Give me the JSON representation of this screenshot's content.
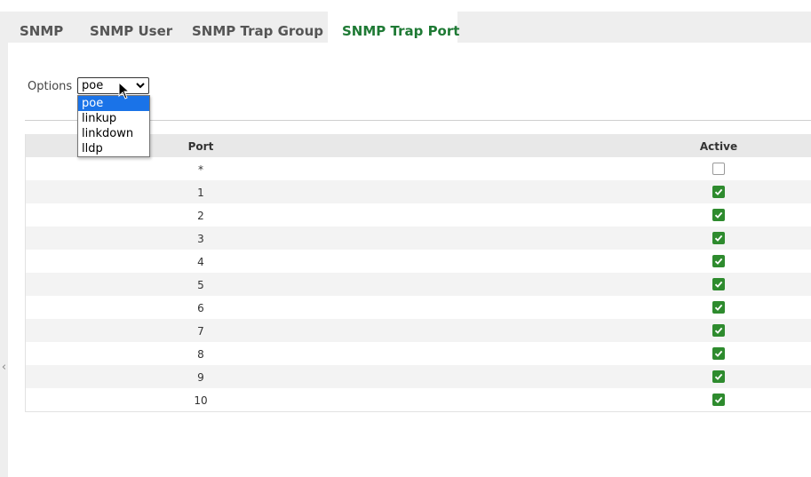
{
  "tabs": [
    {
      "label": "SNMP",
      "active": false
    },
    {
      "label": "SNMP User",
      "active": false
    },
    {
      "label": "SNMP Trap Group",
      "active": false
    },
    {
      "label": "SNMP Trap Port",
      "active": true
    }
  ],
  "options": {
    "label": "Options",
    "selected": "poe",
    "items": [
      "poe",
      "linkup",
      "linkdown",
      "lldp"
    ]
  },
  "table": {
    "headers": {
      "port": "Port",
      "active": "Active"
    },
    "rows": [
      {
        "port": "*",
        "active": false
      },
      {
        "port": "1",
        "active": true
      },
      {
        "port": "2",
        "active": true
      },
      {
        "port": "3",
        "active": true
      },
      {
        "port": "4",
        "active": true
      },
      {
        "port": "5",
        "active": true
      },
      {
        "port": "6",
        "active": true
      },
      {
        "port": "7",
        "active": true
      },
      {
        "port": "8",
        "active": true
      },
      {
        "port": "9",
        "active": true
      },
      {
        "port": "10",
        "active": true
      }
    ]
  },
  "colors": {
    "accent": "#1f7a35",
    "checkbox_on": "#2e8b2e",
    "dropdown_highlight": "#1a73e8"
  },
  "icons": {
    "left_arrow": "chevron-left-icon",
    "select_arrow": "chevron-down-icon",
    "cursor": "mouse-pointer-icon"
  }
}
